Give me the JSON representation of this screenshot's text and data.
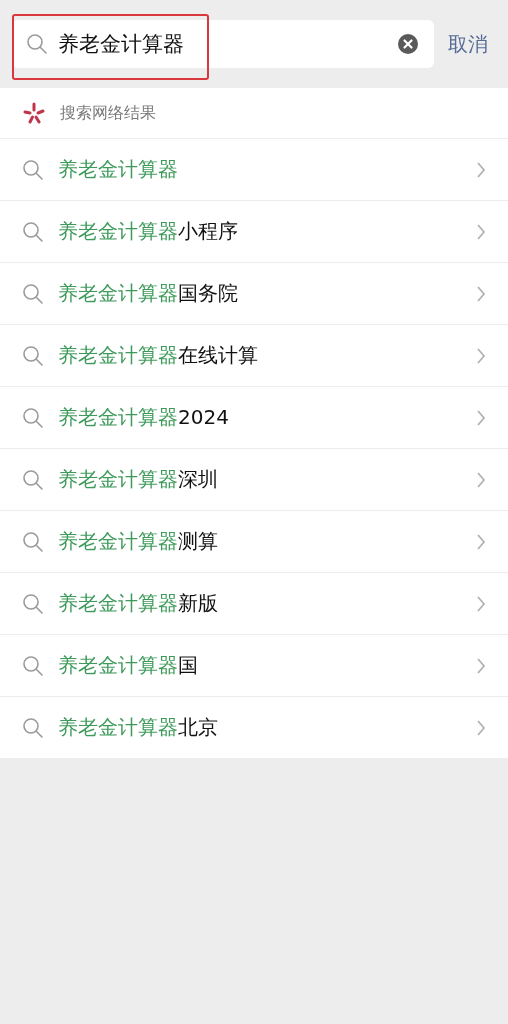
{
  "search": {
    "value": "养老金计算器",
    "highlighted": true
  },
  "cancel": "取消",
  "section_title": "搜索网络结果",
  "suggestions": [
    {
      "match": "养老金计算器"
    },
    {
      "match": "养老金计算器",
      "rest": "小程序"
    },
    {
      "match": "养老金计算器",
      "rest": "国务院"
    },
    {
      "match": "养老金计算器",
      "rest": "在线计算"
    },
    {
      "match": "养老金计算器",
      "rest": "2024"
    },
    {
      "match": "养老金计算器",
      "rest": "深圳"
    },
    {
      "match": "养老金计算器",
      "rest": "测算"
    },
    {
      "match": "养老金计算器",
      "rest": "新版"
    },
    {
      "match": "养老金计算器",
      "rest": "国"
    },
    {
      "match": "养老金计算器",
      "rest": "北京"
    }
  ]
}
